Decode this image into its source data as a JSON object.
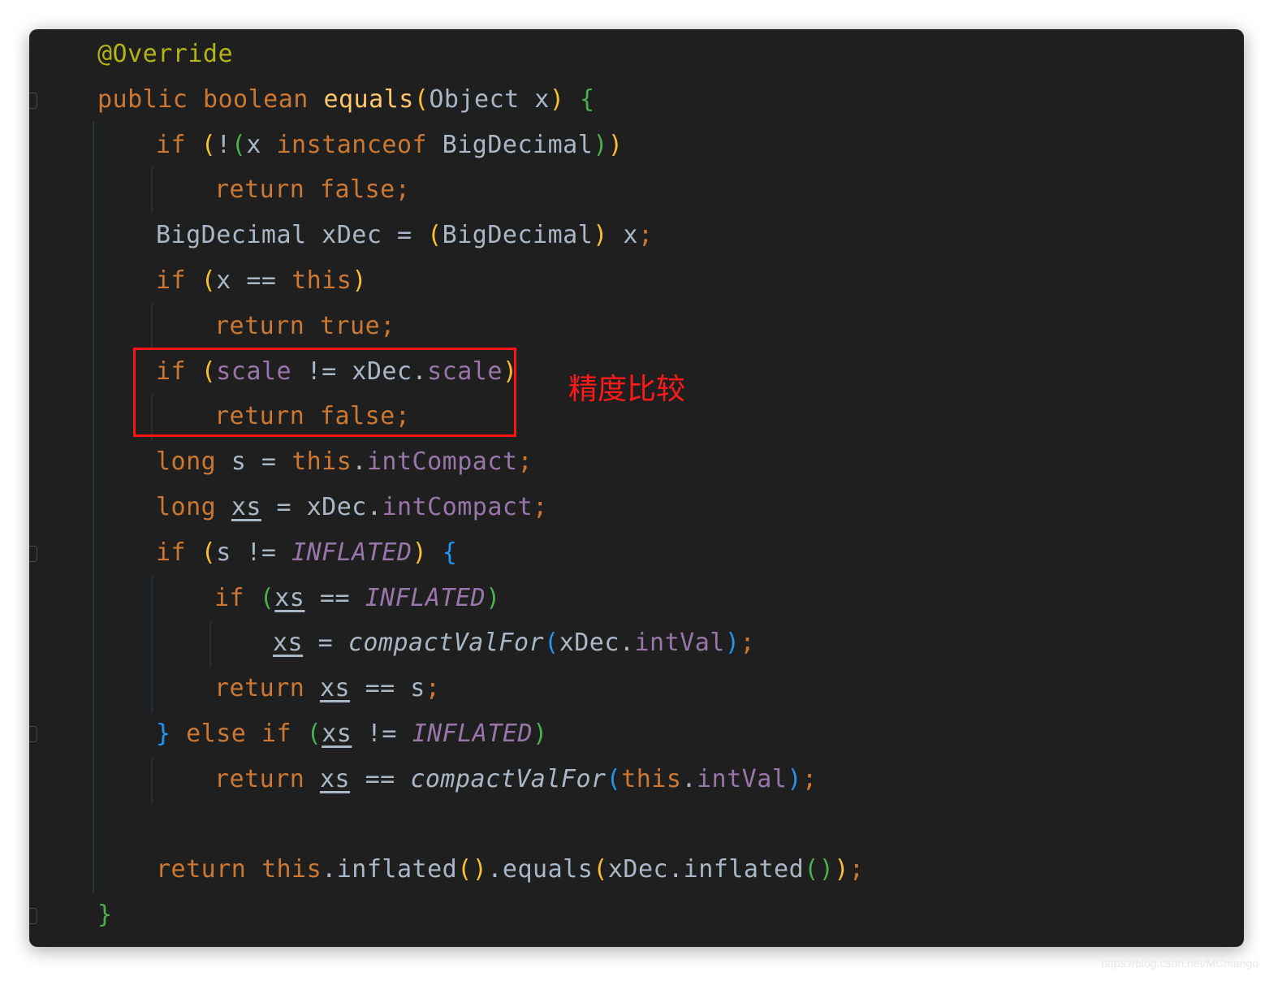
{
  "annotation": "精度比较",
  "watermark": "https://blog.csdn.net/MCmango",
  "colors": {
    "annotation_box": "#ff1414",
    "keyword": "#cc7832",
    "method_declaration": "#ffc66d",
    "field": "#9876aa",
    "annotation_token": "#b4b417",
    "default_text": "#a9b7c6",
    "bracket_level_1": "#fbc02d",
    "bracket_level_2": "#4caf50",
    "bracket_level_3": "#2196f3"
  },
  "code": {
    "lines": [
      [
        {
          "t": "@Override",
          "c": "anno"
        }
      ],
      [
        {
          "t": "public",
          "c": "kw"
        },
        {
          "t": " ",
          "c": "txt"
        },
        {
          "t": "boolean",
          "c": "kw"
        },
        {
          "t": " ",
          "c": "txt"
        },
        {
          "t": "equals",
          "c": "meth"
        },
        {
          "t": "(",
          "c": "p1"
        },
        {
          "t": "Object x",
          "c": "txt"
        },
        {
          "t": ")",
          "c": "p1"
        },
        {
          "t": " ",
          "c": "txt"
        },
        {
          "t": "{",
          "c": "p2"
        }
      ],
      [
        {
          "t": "if",
          "c": "kw"
        },
        {
          "t": " ",
          "c": "txt"
        },
        {
          "t": "(",
          "c": "p1"
        },
        {
          "t": "!",
          "c": "txt"
        },
        {
          "t": "(",
          "c": "p2"
        },
        {
          "t": "x ",
          "c": "txt"
        },
        {
          "t": "instanceof",
          "c": "kw"
        },
        {
          "t": " BigDecimal",
          "c": "txt"
        },
        {
          "t": ")",
          "c": "p2"
        },
        {
          "t": ")",
          "c": "p1"
        }
      ],
      [
        {
          "t": "return",
          "c": "kw"
        },
        {
          "t": " ",
          "c": "txt"
        },
        {
          "t": "false",
          "c": "kw"
        },
        {
          "t": ";",
          "c": "kw"
        }
      ],
      [
        {
          "t": "BigDecimal xDec = ",
          "c": "txt"
        },
        {
          "t": "(",
          "c": "p1"
        },
        {
          "t": "BigDecimal",
          "c": "txt"
        },
        {
          "t": ")",
          "c": "p1"
        },
        {
          "t": " x",
          "c": "txt"
        },
        {
          "t": ";",
          "c": "kw"
        }
      ],
      [
        {
          "t": "if",
          "c": "kw"
        },
        {
          "t": " ",
          "c": "txt"
        },
        {
          "t": "(",
          "c": "p1"
        },
        {
          "t": "x == ",
          "c": "txt"
        },
        {
          "t": "this",
          "c": "kw"
        },
        {
          "t": ")",
          "c": "p1"
        }
      ],
      [
        {
          "t": "return",
          "c": "kw"
        },
        {
          "t": " ",
          "c": "txt"
        },
        {
          "t": "true",
          "c": "kw"
        },
        {
          "t": ";",
          "c": "kw"
        }
      ],
      [
        {
          "t": "if",
          "c": "kw"
        },
        {
          "t": " ",
          "c": "txt"
        },
        {
          "t": "(",
          "c": "p1"
        },
        {
          "t": "scale",
          "c": "fld"
        },
        {
          "t": " != xDec.",
          "c": "txt"
        },
        {
          "t": "scale",
          "c": "fld"
        },
        {
          "t": ")",
          "c": "p1"
        }
      ],
      [
        {
          "t": "return",
          "c": "kw"
        },
        {
          "t": " ",
          "c": "txt"
        },
        {
          "t": "false",
          "c": "kw"
        },
        {
          "t": ";",
          "c": "kw"
        }
      ],
      [
        {
          "t": "long",
          "c": "kw"
        },
        {
          "t": " s = ",
          "c": "txt"
        },
        {
          "t": "this",
          "c": "kw"
        },
        {
          "t": ".",
          "c": "txt"
        },
        {
          "t": "intCompact",
          "c": "fld"
        },
        {
          "t": ";",
          "c": "kw"
        }
      ],
      [
        {
          "t": "long",
          "c": "kw"
        },
        {
          "t": " ",
          "c": "txt"
        },
        {
          "t": "xs",
          "c": "txt u"
        },
        {
          "t": " = xDec.",
          "c": "txt"
        },
        {
          "t": "intCompact",
          "c": "fld"
        },
        {
          "t": ";",
          "c": "kw"
        }
      ],
      [
        {
          "t": "if",
          "c": "kw"
        },
        {
          "t": " ",
          "c": "txt"
        },
        {
          "t": "(",
          "c": "p1"
        },
        {
          "t": "s != ",
          "c": "txt"
        },
        {
          "t": "INFLATED",
          "c": "cst"
        },
        {
          "t": ")",
          "c": "p1"
        },
        {
          "t": " ",
          "c": "txt"
        },
        {
          "t": "{",
          "c": "p3"
        }
      ],
      [
        {
          "t": "if",
          "c": "kw"
        },
        {
          "t": " ",
          "c": "txt"
        },
        {
          "t": "(",
          "c": "p2"
        },
        {
          "t": "xs",
          "c": "txt u"
        },
        {
          "t": " == ",
          "c": "txt"
        },
        {
          "t": "INFLATED",
          "c": "cst"
        },
        {
          "t": ")",
          "c": "p2"
        }
      ],
      [
        {
          "t": "xs",
          "c": "txt u"
        },
        {
          "t": " = ",
          "c": "txt"
        },
        {
          "t": "compactValFor",
          "c": "ital"
        },
        {
          "t": "(",
          "c": "p3"
        },
        {
          "t": "xDec.",
          "c": "txt"
        },
        {
          "t": "intVal",
          "c": "fld"
        },
        {
          "t": ")",
          "c": "p3"
        },
        {
          "t": ";",
          "c": "kw"
        }
      ],
      [
        {
          "t": "return",
          "c": "kw"
        },
        {
          "t": " ",
          "c": "txt"
        },
        {
          "t": "xs",
          "c": "txt u"
        },
        {
          "t": " == s",
          "c": "txt"
        },
        {
          "t": ";",
          "c": "kw"
        }
      ],
      [
        {
          "t": "}",
          "c": "p3"
        },
        {
          "t": " ",
          "c": "txt"
        },
        {
          "t": "else",
          "c": "kw"
        },
        {
          "t": " ",
          "c": "txt"
        },
        {
          "t": "if",
          "c": "kw"
        },
        {
          "t": " ",
          "c": "txt"
        },
        {
          "t": "(",
          "c": "p2"
        },
        {
          "t": "xs",
          "c": "txt u"
        },
        {
          "t": " != ",
          "c": "txt"
        },
        {
          "t": "INFLATED",
          "c": "cst"
        },
        {
          "t": ")",
          "c": "p2"
        }
      ],
      [
        {
          "t": "return",
          "c": "kw"
        },
        {
          "t": " ",
          "c": "txt"
        },
        {
          "t": "xs",
          "c": "txt u"
        },
        {
          "t": " == ",
          "c": "txt"
        },
        {
          "t": "compactValFor",
          "c": "ital"
        },
        {
          "t": "(",
          "c": "p3"
        },
        {
          "t": "this",
          "c": "kw"
        },
        {
          "t": ".",
          "c": "txt"
        },
        {
          "t": "intVal",
          "c": "fld"
        },
        {
          "t": ")",
          "c": "p3"
        },
        {
          "t": ";",
          "c": "kw"
        }
      ],
      [],
      [
        {
          "t": "return",
          "c": "kw"
        },
        {
          "t": " ",
          "c": "txt"
        },
        {
          "t": "this",
          "c": "kw"
        },
        {
          "t": ".inflated",
          "c": "txt"
        },
        {
          "t": "()",
          "c": "p1"
        },
        {
          "t": ".equals",
          "c": "txt"
        },
        {
          "t": "(",
          "c": "p1"
        },
        {
          "t": "xDec.inflated",
          "c": "txt"
        },
        {
          "t": "()",
          "c": "p2"
        },
        {
          "t": ")",
          "c": "p1"
        },
        {
          "t": ";",
          "c": "kw"
        }
      ],
      [
        {
          "t": "}",
          "c": "p2"
        }
      ]
    ]
  }
}
